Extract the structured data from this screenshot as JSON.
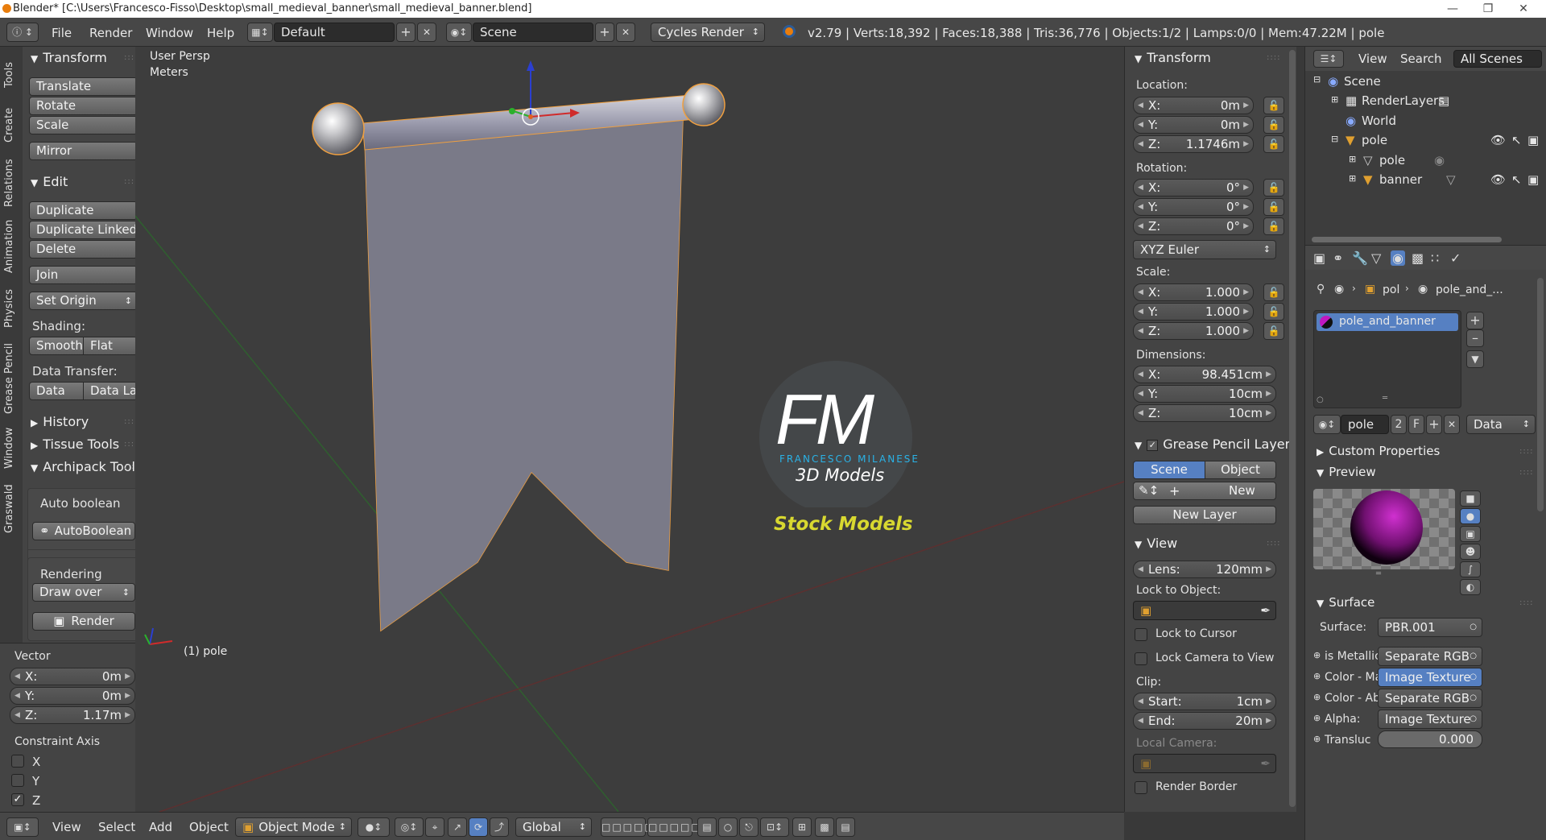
{
  "titlebar": {
    "title": "Blender* [C:\\Users\\Francesco-Fisso\\Desktop\\small_medieval_banner\\small_medieval_banner.blend]"
  },
  "menubar": {
    "menus": [
      "File",
      "Render",
      "Window",
      "Help"
    ],
    "screen_layout": "Default",
    "scene": "Scene",
    "render_engine": "Cycles Render",
    "stats": "v2.79 | Verts:18,392 | Faces:18,388 | Tris:36,776 | Objects:1/2 | Lamps:0/0 | Mem:47.22M | pole"
  },
  "vtabs": [
    "Tools",
    "Create",
    "Relations",
    "Animation",
    "Physics",
    "Grease Pencil",
    "Window",
    "Graswald"
  ],
  "toolshelf": {
    "transform": {
      "header": "Transform",
      "translate": "Translate",
      "rotate": "Rotate",
      "scale": "Scale",
      "mirror": "Mirror"
    },
    "edit": {
      "header": "Edit",
      "duplicate": "Duplicate",
      "duplicate_linked": "Duplicate Linked",
      "delete": "Delete",
      "join": "Join",
      "set_origin": "Set Origin",
      "shading_label": "Shading:",
      "smooth": "Smooth",
      "flat": "Flat",
      "data_transfer_label": "Data Transfer:",
      "data": "Data",
      "data_la": "Data La"
    },
    "history": "History",
    "tissue": "Tissue Tools",
    "archipack": "Archipack Tools",
    "auto_boolean_label": "Auto boolean",
    "auto_boolean_btn": "AutoBoolean",
    "rendering_label": "Rendering",
    "draw_over": "Draw over",
    "render_btn": "Render"
  },
  "operator": {
    "vector_label": "Vector",
    "x": {
      "label": "X:",
      "value": "0m"
    },
    "y": {
      "label": "Y:",
      "value": "0m"
    },
    "z": {
      "label": "Z:",
      "value": "1.17m"
    },
    "constraint_label": "Constraint Axis",
    "axes": [
      {
        "label": "X",
        "checked": false
      },
      {
        "label": "Y",
        "checked": false
      },
      {
        "label": "Z",
        "checked": true
      }
    ]
  },
  "viewport": {
    "view_name": "User Persp",
    "units": "Meters",
    "object_label": "(1) pole",
    "watermark": {
      "fm": "FM",
      "line1": "FRANCESCO MILANESE",
      "line2": "3D Models",
      "stock": "Stock Models"
    }
  },
  "bottombar": {
    "view": "View",
    "select": "Select",
    "add": "Add",
    "object": "Object",
    "mode": "Object Mode",
    "orientation": "Global"
  },
  "properties_n": {
    "transform_header": "Transform",
    "location_label": "Location:",
    "location": [
      {
        "label": "X:",
        "value": "0m"
      },
      {
        "label": "Y:",
        "value": "0m"
      },
      {
        "label": "Z:",
        "value": "1.1746m"
      }
    ],
    "rotation_label": "Rotation:",
    "rotation": [
      {
        "label": "X:",
        "value": "0°"
      },
      {
        "label": "Y:",
        "value": "0°"
      },
      {
        "label": "Z:",
        "value": "0°"
      }
    ],
    "rotation_mode": "XYZ Euler",
    "scale_label": "Scale:",
    "scale": [
      {
        "label": "X:",
        "value": "1.000"
      },
      {
        "label": "Y:",
        "value": "1.000"
      },
      {
        "label": "Z:",
        "value": "1.000"
      }
    ],
    "dimensions_label": "Dimensions:",
    "dimensions": [
      {
        "label": "X:",
        "value": "98.451cm"
      },
      {
        "label": "Y:",
        "value": "10cm"
      },
      {
        "label": "Z:",
        "value": "10cm"
      }
    ],
    "gp_header": "Grease Pencil Layer",
    "gp_scene": "Scene",
    "gp_object": "Object",
    "gp_new": "New",
    "gp_new_layer": "New Layer",
    "view_header": "View",
    "lens": {
      "label": "Lens:",
      "value": "120mm"
    },
    "lock_object_label": "Lock to Object:",
    "lock_cursor": "Lock to Cursor",
    "lock_camera": "Lock Camera to View",
    "clip_label": "Clip:",
    "clip_start": {
      "label": "Start:",
      "value": "1cm"
    },
    "clip_end": {
      "label": "End:",
      "value": "20m"
    },
    "local_camera_label": "Local Camera:",
    "render_border": "Render Border"
  },
  "outliner": {
    "view": "View",
    "search": "Search",
    "all_scenes": "All Scenes",
    "items": [
      {
        "label": "Scene"
      },
      {
        "label": "RenderLayers"
      },
      {
        "label": "World"
      },
      {
        "label": "pole"
      },
      {
        "label": "pole"
      },
      {
        "label": "banner"
      }
    ]
  },
  "material": {
    "breadcrumb_obj": "pol",
    "breadcrumb_mat": "pole_and_...",
    "slot_name": "pole_and_banner",
    "datablock_name": "pole",
    "users": "2",
    "fake": "F",
    "link": "Data",
    "custom_props": "Custom Properties",
    "preview": "Preview",
    "surface_header": "Surface",
    "surface_label": "Surface:",
    "surface_value": "PBR.001",
    "inputs": [
      {
        "label": "is Metallic",
        "value": "Separate RGB"
      },
      {
        "label": "Color - Ma",
        "value": "Image Texture"
      },
      {
        "label": "Color - Ab",
        "value": "Separate RGB"
      },
      {
        "label": "Alpha:",
        "value": "Image Texture"
      },
      {
        "label": "Transluc",
        "value": "0.000"
      }
    ],
    "accent": "#5680c2"
  }
}
